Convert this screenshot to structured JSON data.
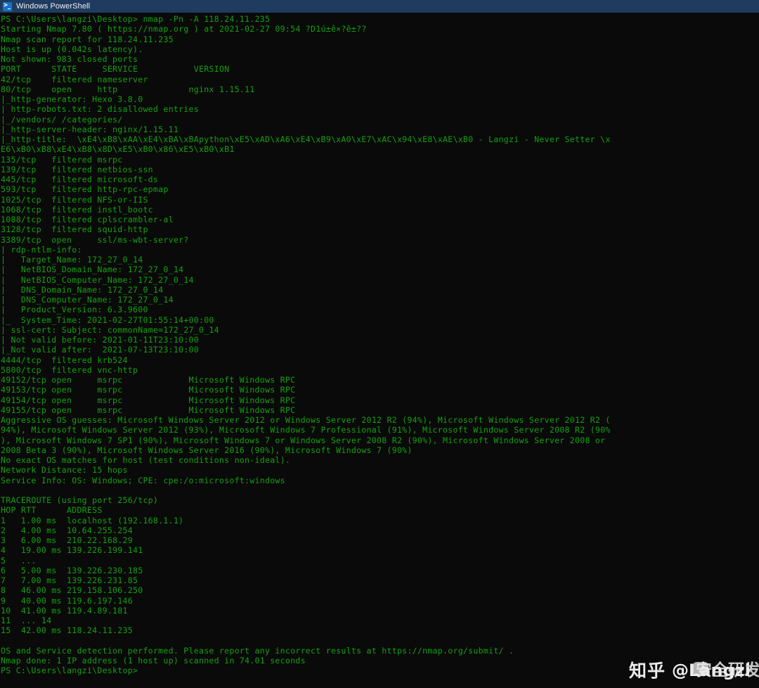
{
  "window": {
    "title": "Windows PowerShell",
    "icon": "powershell-icon",
    "titlebar_color": "#1f3c60",
    "console_bg": "#0a0a0a",
    "console_fg": "#13a10e"
  },
  "console": {
    "lines": [
      "PS C:\\Users\\langzi\\Desktop> nmap -Pn -A 118.24.11.235",
      "Starting Nmap 7.80 ( https://nmap.org ) at 2021-02-27 09:54 ?D1ú±ê×?ê±??",
      "Nmap scan report for 118.24.11.235",
      "Host is up (0.042s latency).",
      "Not shown: 983 closed ports",
      "PORT      STATE     SERVICE           VERSION",
      "42/tcp    filtered nameserver",
      "80/tcp    open     http              nginx 1.15.11",
      "|_http-generator: Hexo 3.8.0",
      "| http-robots.txt: 2 disallowed entries",
      "|_/vendors/ /categories/",
      "|_http-server-header: nginx/1.15.11",
      "|_http-title:  \\xE4\\xB8\\xAA\\xE4\\xBA\\xBApython\\xE5\\xAD\\xA6\\xE4\\xB9\\xA0\\xE7\\xAC\\x94\\xE8\\xAE\\xB0 - Langzi - Never Setter \\x",
      "E6\\xB0\\xB8\\xE4\\xB8\\x8D\\xE5\\xB0\\x86\\xE5\\xB0\\xB1",
      "135/tcp   filtered msrpc",
      "139/tcp   filtered netbios-ssn",
      "445/tcp   filtered microsoft-ds",
      "593/tcp   filtered http-rpc-epmap",
      "1025/tcp  filtered NFS-or-IIS",
      "1068/tcp  filtered instl_bootc",
      "1088/tcp  filtered cplscrambler-al",
      "3128/tcp  filtered squid-http",
      "3389/tcp  open     ssl/ms-wbt-server?",
      "| rdp-ntlm-info:",
      "|   Target_Name: 172_27_0_14",
      "|   NetBIOS_Domain_Name: 172_27_0_14",
      "|   NetBIOS_Computer_Name: 172_27_0_14",
      "|   DNS_Domain_Name: 172_27_0_14",
      "|   DNS_Computer_Name: 172_27_0_14",
      "|   Product_Version: 6.3.9600",
      "|_  System_Time: 2021-02-27T01:55:14+00:00",
      "| ssl-cert: Subject: commonName=172_27_0_14",
      "| Not valid before: 2021-01-11T23:10:00",
      "|_Not valid after:  2021-07-13T23:10:00",
      "4444/tcp  filtered krb524",
      "5800/tcp  filtered vnc-http",
      "49152/tcp open     msrpc             Microsoft Windows RPC",
      "49153/tcp open     msrpc             Microsoft Windows RPC",
      "49154/tcp open     msrpc             Microsoft Windows RPC",
      "49155/tcp open     msrpc             Microsoft Windows RPC",
      "Aggressive OS guesses: Microsoft Windows Server 2012 or Windows Server 2012 R2 (94%), Microsoft Windows Server 2012 R2 (",
      "94%), Microsoft Windows Server 2012 (93%), Microsoft Windows 7 Professional (91%), Microsoft Windows Server 2008 R2 (90%",
      "), Microsoft Windows 7 SP1 (90%), Microsoft Windows 7 or Windows Server 2008 R2 (90%), Microsoft Windows Server 2008 or",
      "2008 Beta 3 (90%), Microsoft Windows Server 2016 (90%), Microsoft Windows 7 (90%)",
      "No exact OS matches for host (test conditions non-ideal).",
      "Network Distance: 15 hops",
      "Service Info: OS: Windows; CPE: cpe:/o:microsoft:windows",
      "",
      "TRACEROUTE (using port 256/tcp)",
      "HOP RTT      ADDRESS",
      "1   1.00 ms  localhost (192.168.1.1)",
      "2   4.00 ms  10.64.255.254",
      "3   6.00 ms  210.22.168.29",
      "4   19.00 ms 139.226.199.141",
      "5   ...",
      "6   5.00 ms  139.226.230.185",
      "7   7.00 ms  139.226.231.85",
      "8   46.00 ms 219.158.106.250",
      "9   40.00 ms 119.6.197.146",
      "10  41.00 ms 119.4.89.181",
      "11  ... 14",
      "15  42.00 ms 118.24.11.235",
      "",
      "OS and Service detection performed. Please report any incorrect results at https://nmap.org/submit/ .",
      "Nmap done: 1 IP address (1 host up) scanned in 74.01 seconds",
      "PS C:\\Users\\langzi\\Desktop>"
    ]
  },
  "watermark": {
    "logo": "知乎",
    "handle": "@Langzi",
    "handle_overlay": "安全研发"
  }
}
